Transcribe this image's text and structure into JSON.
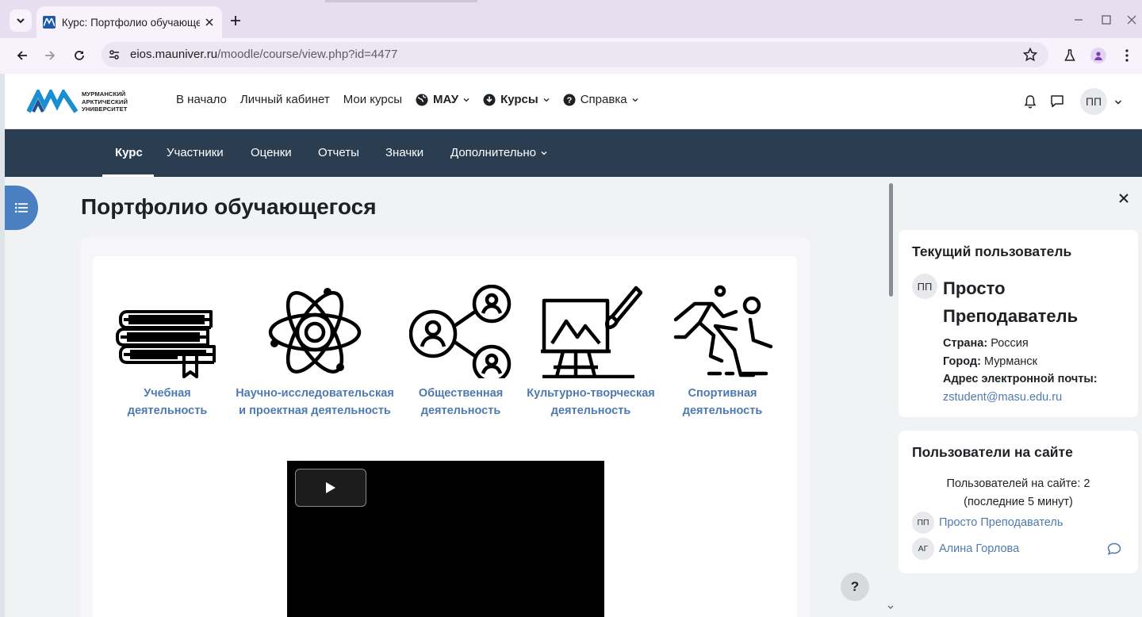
{
  "browser": {
    "tab_title": "Курс: Портфолио обучающег",
    "url_host": "eios.mauniver.ru",
    "url_path": "/moodle/course/view.php?id=4477"
  },
  "header": {
    "logo_line1": "МУРМАНСКИЙ",
    "logo_line2": "АРКТИЧЕСКИЙ",
    "logo_line3": "УНИВЕРСИТЕТ",
    "nav": {
      "home": "В начало",
      "dashboard": "Личный кабинет",
      "my_courses": "Мои курсы",
      "mau": "МАУ",
      "courses": "Курсы",
      "help": "Справка"
    },
    "user_initials": "ПП"
  },
  "secondary_nav": {
    "course": "Курс",
    "participants": "Участники",
    "grades": "Оценки",
    "reports": "Отчеты",
    "badges": "Значки",
    "more": "Дополнительно"
  },
  "page": {
    "title": "Портфолио обучающегося",
    "activities": [
      {
        "line1": "Учебная",
        "line2": "деятельность",
        "icon": "books-icon"
      },
      {
        "line1": "Научно-исследовательская",
        "line2": "и проектная деятельность",
        "icon": "atom-icon"
      },
      {
        "line1": "Общественная",
        "line2": "деятельность",
        "icon": "network-people-icon"
      },
      {
        "line1": "Культурно-творческая",
        "line2": "деятельность",
        "icon": "easel-icon"
      },
      {
        "line1": "Спортивная",
        "line2": "деятельность",
        "icon": "runner-icon"
      }
    ],
    "help_label": "?"
  },
  "drawer": {
    "current_user": {
      "heading": "Текущий пользователь",
      "initials": "ПП",
      "name_line1": "Просто",
      "name_line2": "Преподаватель",
      "country_label": "Страна:",
      "country": "Россия",
      "city_label": "Город:",
      "city": "Мурманск",
      "email_label": "Адрес электронной почты:",
      "email": "zstudent@masu.edu.ru"
    },
    "online_users": {
      "heading": "Пользователи на сайте",
      "summary_line1": "Пользователей на сайте: 2",
      "summary_line2": "(последние 5 минут)",
      "users": [
        {
          "initials": "ПП",
          "name": "Просто Преподаватель"
        },
        {
          "initials": "АГ",
          "name": "Алина Горлова"
        }
      ]
    }
  }
}
